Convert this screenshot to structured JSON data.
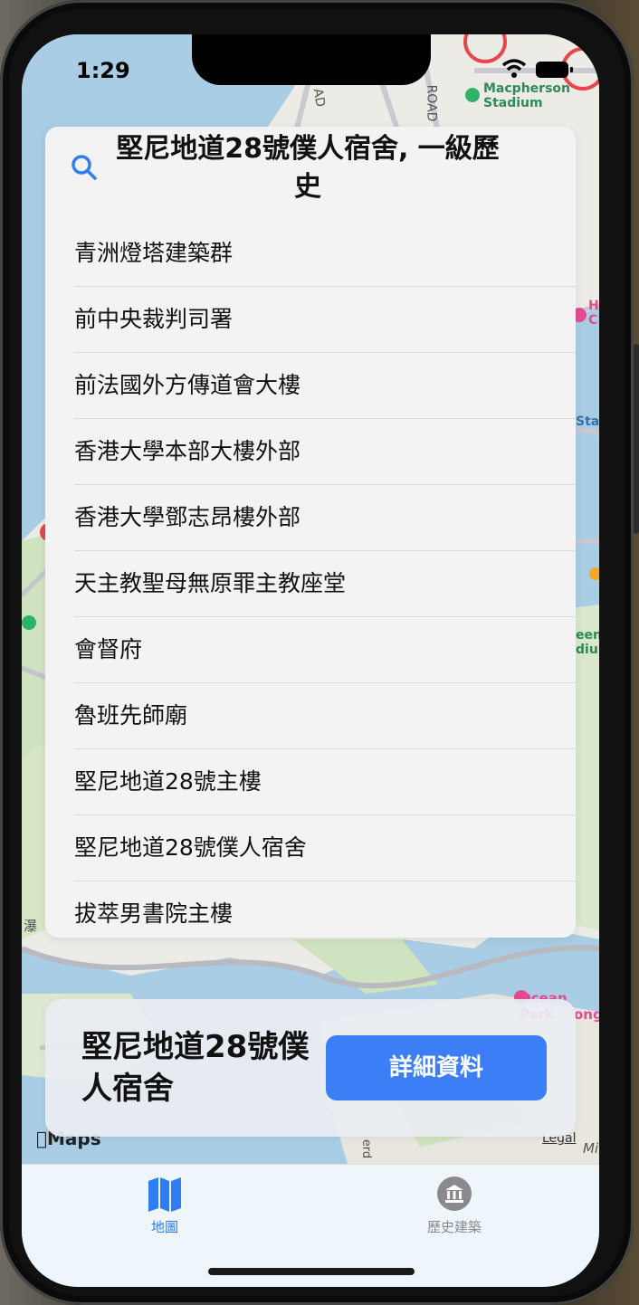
{
  "status_bar": {
    "time": "1:29"
  },
  "map": {
    "poi_macpherson": "Macpherson\nStadium",
    "label_ad": "AD",
    "label_road": "ROAD",
    "label_ocean_park": "Ocean Park",
    "label_ong": "ong",
    "label_sta": "Sta",
    "label_een": "een",
    "label_diu": "diu",
    "label_h": "H",
    "label_c": "C",
    "label_pu": "瀑",
    "label_mi": "Mi",
    "label_erd": "erd",
    "brand": "Maps",
    "legal": "Legal"
  },
  "search": {
    "query": "堅尼地道28號僕人宿舍, 一級歷史",
    "results": [
      "青洲燈塔建築群",
      "前中央裁判司署",
      "前法國外方傳道會大樓",
      "香港大學本部大樓外部",
      "香港大學鄧志昂樓外部",
      "天主教聖母無原罪主教座堂",
      "會督府",
      "魯班先師廟",
      "堅尼地道28號主樓",
      "堅尼地道28號僕人宿舍",
      "拔萃男書院主樓"
    ]
  },
  "card": {
    "title": "堅尼地道28號僕人宿舍",
    "detail_button": "詳細資料"
  },
  "tabs": {
    "map_label": "地圖",
    "heritage_label": "歷史建築",
    "active_color": "#2f7cf3",
    "inactive_color": "#8a8a8e"
  }
}
